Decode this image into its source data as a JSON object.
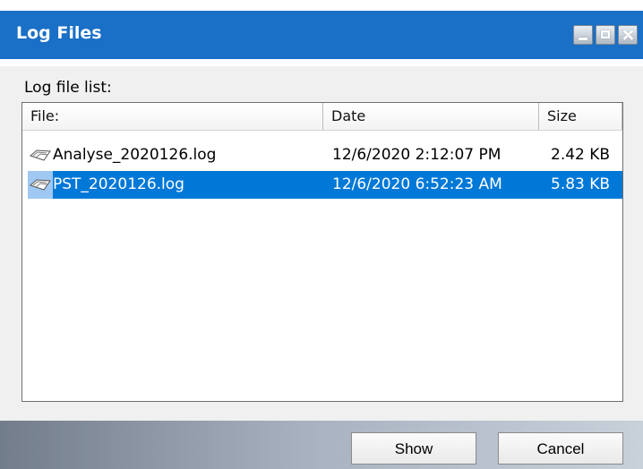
{
  "window": {
    "title": "Log Files",
    "controls": [
      "minimize",
      "maximize",
      "close"
    ]
  },
  "log_file_list": {
    "label": "Log file list:",
    "columns": [
      "File:",
      "Date",
      "Size"
    ],
    "rows": [
      {
        "file": "Analyse_2020126.log",
        "date": "12/6/2020 2:12:07 PM",
        "size": "2.42 KB",
        "selected": false
      },
      {
        "file": "PST_2020126.log",
        "date": "12/6/2020 6:52:23 AM",
        "size": "5.83 KB",
        "selected": true
      }
    ]
  },
  "buttons": {
    "show": "Show",
    "cancel": "Cancel"
  },
  "icons": {
    "file_row_icon": "log-file-icon",
    "minimize": "minimize-icon",
    "maximize": "maximize-icon",
    "close": "close-icon"
  },
  "colors": {
    "title_bar": "#1a6fc6",
    "selection": "#0078d7",
    "selection_icon_background": "#9fc8f3"
  }
}
